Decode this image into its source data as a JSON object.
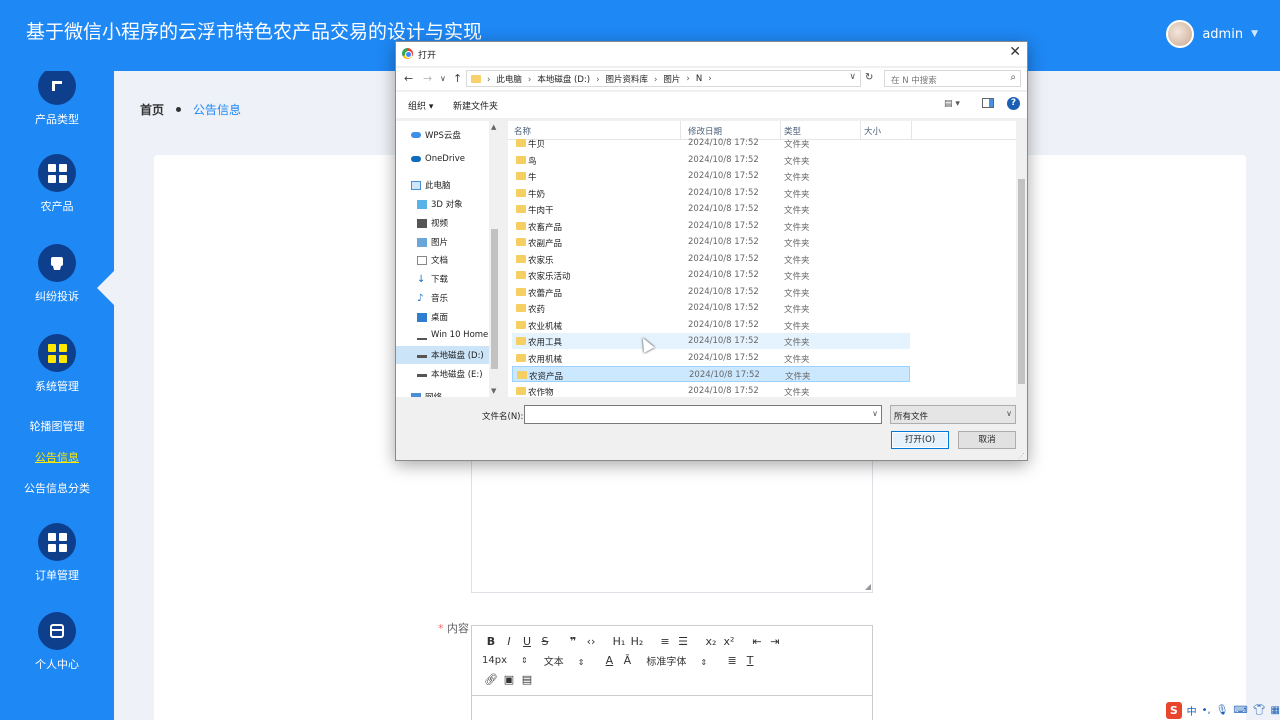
{
  "app": {
    "title": "基于微信小程序的云浮市特色农产品交易的设计与实现",
    "user": "admin"
  },
  "sidebar": {
    "items": [
      {
        "label": "产品类型",
        "icon": "category-icon"
      },
      {
        "label": "农产品",
        "icon": "grid-icon"
      },
      {
        "label": "纠纷投诉",
        "icon": "complaint-icon"
      },
      {
        "label": "系统管理",
        "icon": "grid-icon",
        "active": true
      },
      {
        "label": "订单管理",
        "icon": "grid-icon"
      },
      {
        "label": "个人中心",
        "icon": "wallet-icon"
      }
    ],
    "subitems": [
      {
        "label": "轮播图管理"
      },
      {
        "label": "公告信息",
        "active": true
      },
      {
        "label": "公告信息分类"
      }
    ]
  },
  "breadcrumb": {
    "home": "首页",
    "current": "公告信息"
  },
  "form": {
    "content_label": "内容",
    "required_mark": "*"
  },
  "editor": {
    "font_size": "14px",
    "block_type": "文本",
    "font_family": "标准字体"
  },
  "dialog": {
    "title": "打开",
    "path": [
      "此电脑",
      "本地磁盘 (D:)",
      "图片资料库",
      "图片",
      "N"
    ],
    "search_placeholder": "在 N 中搜索",
    "organize": "组织 ▾",
    "new_folder": "新建文件夹",
    "tree": [
      {
        "label": "WPS云盘",
        "icon": "cloud-icon"
      },
      {
        "label": "OneDrive",
        "icon": "onedrive-icon"
      },
      {
        "label": "此电脑",
        "icon": "computer-icon"
      },
      {
        "label": "3D 对象",
        "icon": "3d-icon"
      },
      {
        "label": "视频",
        "icon": "video-icon"
      },
      {
        "label": "图片",
        "icon": "picture-icon"
      },
      {
        "label": "文档",
        "icon": "document-icon"
      },
      {
        "label": "下载",
        "icon": "download-icon"
      },
      {
        "label": "音乐",
        "icon": "music-icon"
      },
      {
        "label": "桌面",
        "icon": "desktop-icon"
      },
      {
        "label": "Win 10 Home",
        "icon": "network-drive-icon"
      },
      {
        "label": "本地磁盘 (D:)",
        "icon": "drive-icon",
        "selected": true
      },
      {
        "label": "本地磁盘 (E:)",
        "icon": "drive-icon"
      },
      {
        "label": "网络",
        "icon": "network-icon"
      }
    ],
    "columns": [
      "名称",
      "修改日期",
      "类型",
      "大小"
    ],
    "files": [
      {
        "name": "牛贝",
        "date": "2024/10/8 17:52",
        "type": "文件夹"
      },
      {
        "name": "鸟",
        "date": "2024/10/8 17:52",
        "type": "文件夹"
      },
      {
        "name": "牛",
        "date": "2024/10/8 17:52",
        "type": "文件夹"
      },
      {
        "name": "牛奶",
        "date": "2024/10/8 17:52",
        "type": "文件夹"
      },
      {
        "name": "牛肉干",
        "date": "2024/10/8 17:52",
        "type": "文件夹"
      },
      {
        "name": "农畜产品",
        "date": "2024/10/8 17:52",
        "type": "文件夹"
      },
      {
        "name": "农副产品",
        "date": "2024/10/8 17:52",
        "type": "文件夹"
      },
      {
        "name": "农家乐",
        "date": "2024/10/8 17:52",
        "type": "文件夹"
      },
      {
        "name": "农家乐活动",
        "date": "2024/10/8 17:52",
        "type": "文件夹"
      },
      {
        "name": "农蕾产品",
        "date": "2024/10/8 17:52",
        "type": "文件夹"
      },
      {
        "name": "农药",
        "date": "2024/10/8 17:52",
        "type": "文件夹"
      },
      {
        "name": "农业机械",
        "date": "2024/10/8 17:52",
        "type": "文件夹"
      },
      {
        "name": "农用工具",
        "date": "2024/10/8 17:52",
        "type": "文件夹",
        "hover": true
      },
      {
        "name": "农用机械",
        "date": "2024/10/8 17:52",
        "type": "文件夹"
      },
      {
        "name": "农资产品",
        "date": "2024/10/8 17:52",
        "type": "文件夹",
        "selected": true
      },
      {
        "name": "农作物",
        "date": "2024/10/8 17:52",
        "type": "文件夹"
      }
    ],
    "filename_label": "文件名(N):",
    "filename_value": "",
    "filetype": "所有文件",
    "open_button": "打开(O)",
    "cancel_button": "取消"
  },
  "tray": {
    "ime_logo": "S",
    "ime_lang": "中"
  }
}
